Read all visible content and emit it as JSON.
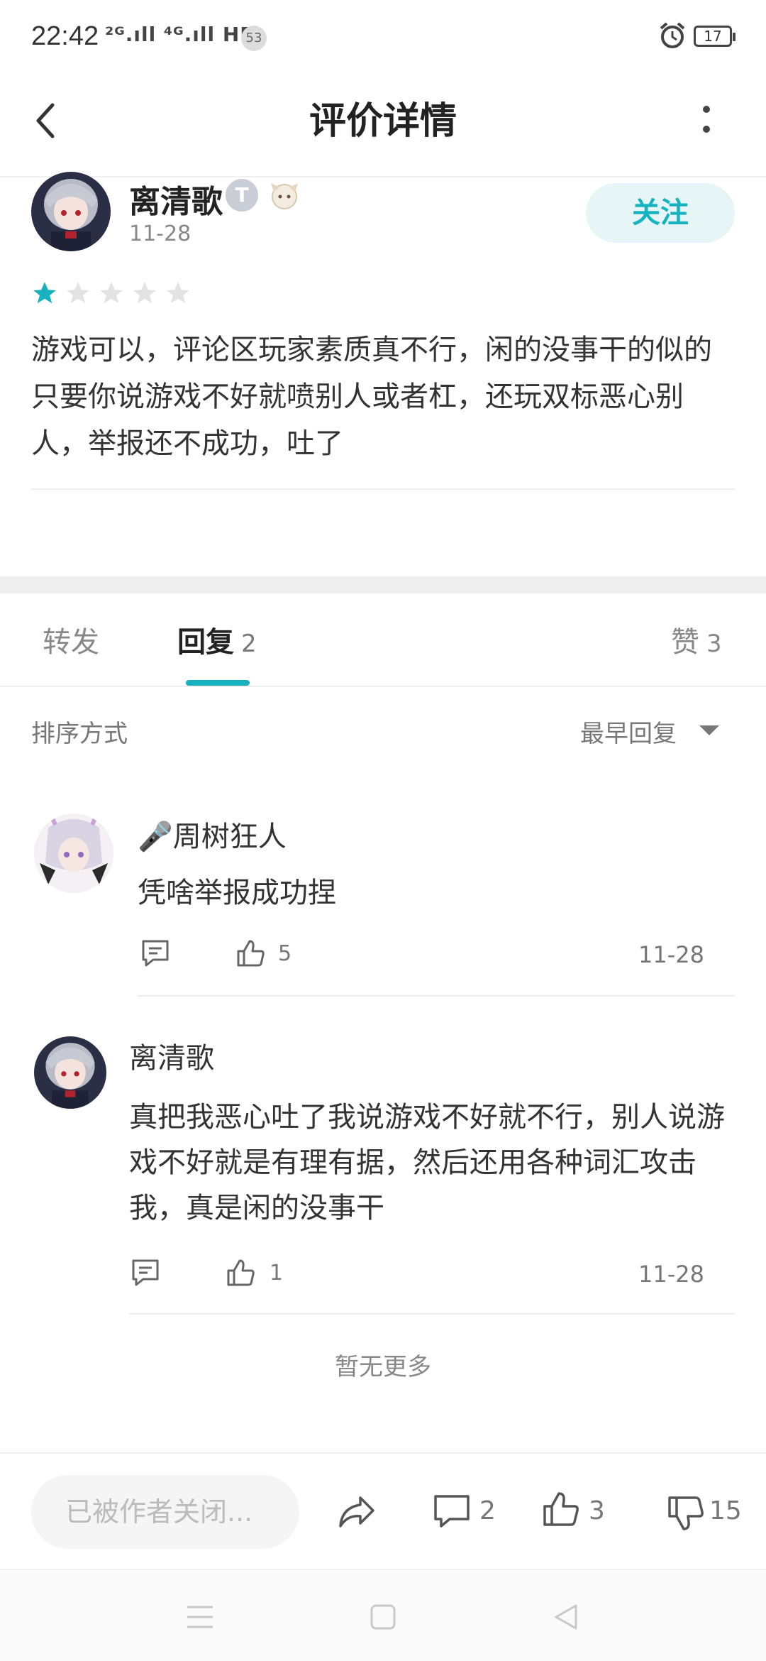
{
  "status_bar": {
    "time": "22:42",
    "signal": "²ᴳ.ıll ⁴ᴳ.ıll HD",
    "notif_count": "53",
    "battery": "17",
    "icons": [
      "signal-icon",
      "hd-icon",
      "alarm-icon",
      "battery-icon"
    ]
  },
  "header": {
    "title": "评价详情",
    "back_icon": "back-arrow-icon",
    "more_icon": "more-vertical-icon"
  },
  "review": {
    "author": "离清歌",
    "badge_letter": "T",
    "date": "11-28",
    "follow_label": "关注",
    "rating": 1,
    "rating_max": 5,
    "text": "游戏可以，评论区玩家素质真不行，闲的没事干的似的只要你说游戏不好就喷别人或者杠，还玩双标恶心别人，举报还不成功，吐了"
  },
  "tabs": {
    "forward": "转发",
    "reply": "回复",
    "reply_count": "2",
    "like": "赞",
    "like_count": "3"
  },
  "sort": {
    "label": "排序方式",
    "value": "最早回复"
  },
  "replies": [
    {
      "name": "🎤周树狂人",
      "text": "凭啥举报成功捏",
      "likes": "5",
      "date": "11-28"
    },
    {
      "name": "离清歌",
      "text": "真把我恶心吐了我说游戏不好就不行，别人说游戏不好就是有理有据，然后还用各种词汇攻击我，真是闲的没事干",
      "likes": "1",
      "date": "11-28"
    }
  ],
  "no_more": "暂无更多",
  "bottom_bar": {
    "input_placeholder": "已被作者关闭...",
    "comment_count": "2",
    "like_count": "3",
    "dislike_count": "15"
  },
  "colors": {
    "accent": "#16b2c0",
    "follow_bg": "#e6f6f7",
    "separator": "#efefef"
  }
}
